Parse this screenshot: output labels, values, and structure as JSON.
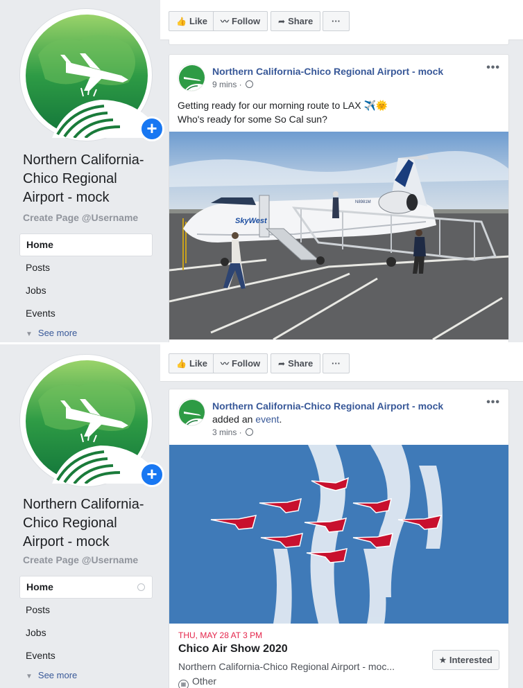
{
  "page": {
    "name": "Northern California-Chico Regional Airport - mock",
    "username": "Create Page @Username"
  },
  "nav": {
    "items": [
      {
        "label": "Home"
      },
      {
        "label": "Posts"
      },
      {
        "label": "Jobs"
      },
      {
        "label": "Events"
      }
    ],
    "see_more": "See more"
  },
  "actions": {
    "like": "Like",
    "follow": "Follow",
    "share": "Share",
    "more": "···"
  },
  "post1": {
    "author": "Northern California-Chico Regional Airport - mock",
    "time": "9 mins ·",
    "text_line1": "Getting ready for our morning route to LAX ✈️🌞",
    "text_line2": "Who's ready for some So Cal sun?",
    "photo_airline": "SkyWest",
    "photo_tail": "N8981M"
  },
  "post2": {
    "author": "Northern California-Chico Regional Airport - mock",
    "action_prefix": "added an ",
    "action_link": "event",
    "action_suffix": ".",
    "time": "3 mins ·",
    "event": {
      "date": "THU, MAY 28 AT 3 PM",
      "title": "Chico Air Show 2020",
      "host": "Northern California-Chico Regional Airport - moc...",
      "category": "Other",
      "interested": "Interested"
    }
  },
  "colors": {
    "brand_blue": "#385898",
    "facebook_blue": "#1877f2",
    "event_red": "#e4244a",
    "logo_green": "#1e8a3a"
  },
  "icons": [
    "plus-icon",
    "like-icon",
    "follow-rss-icon",
    "share-icon",
    "globe-icon",
    "more-icon",
    "star-icon",
    "calendar-icon",
    "caret-down-icon"
  ]
}
